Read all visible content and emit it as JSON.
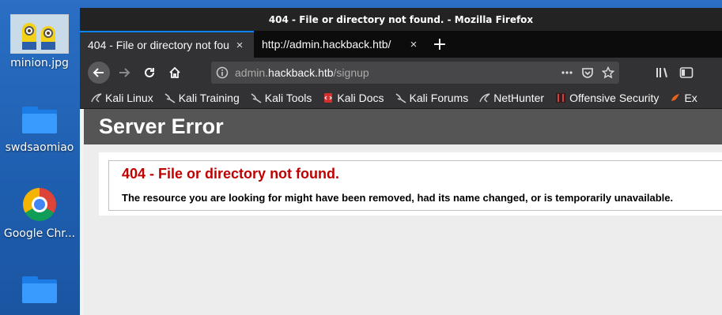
{
  "desktop": {
    "icons": [
      {
        "label": "minion.jpg"
      },
      {
        "label": "swdsaomiao"
      },
      {
        "label": "Google Chr..."
      },
      {
        "label": ""
      }
    ]
  },
  "window": {
    "title": "404 - File or directory not found. - Mozilla Firefox",
    "tabs": [
      {
        "label": "404 - File or directory not found.",
        "close": "×"
      },
      {
        "label": "http://admin.hackback.htb/",
        "close": "×"
      }
    ],
    "new_tab": "+",
    "url": {
      "prefix": "admin.",
      "host": "hackback.htb",
      "path": "/signup"
    },
    "bookmarks": [
      {
        "label": "Kali Linux",
        "icon": "kali-dragon-icon"
      },
      {
        "label": "Kali Training",
        "icon": "kali-dragon-icon"
      },
      {
        "label": "Kali Tools",
        "icon": "kali-dragon-icon"
      },
      {
        "label": "Kali Docs",
        "icon": "kali-docs-icon"
      },
      {
        "label": "Kali Forums",
        "icon": "kali-dragon-icon"
      },
      {
        "label": "NetHunter",
        "icon": "nethunter-icon"
      },
      {
        "label": "Offensive Security",
        "icon": "offsec-icon"
      },
      {
        "label": "Ex",
        "icon": "exploit-db-icon"
      }
    ]
  },
  "page": {
    "header": "Server Error",
    "error_title": "404 - File or directory not found.",
    "error_message": "The resource you are looking for might have been removed, had its name changed, or is temporarily unavailable."
  },
  "colors": {
    "accent": "#0a84ff",
    "error_red": "#c00000",
    "header_bg": "#555555"
  }
}
